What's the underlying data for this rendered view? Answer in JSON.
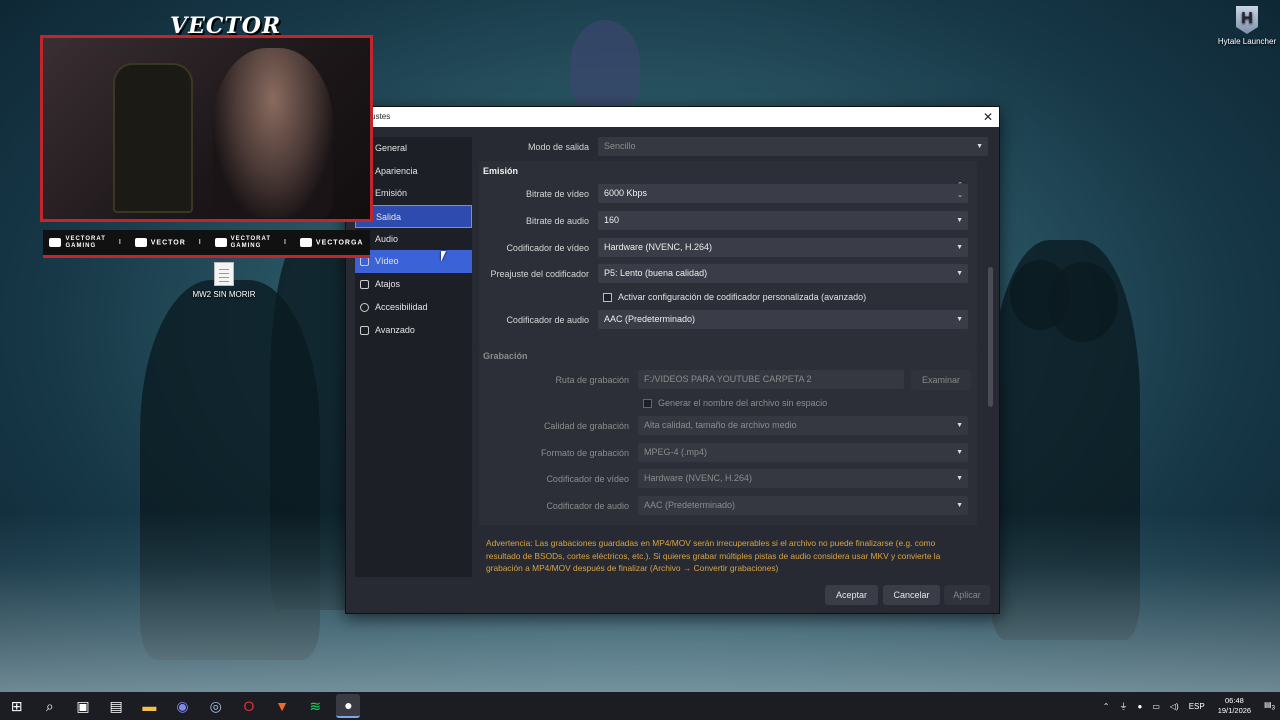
{
  "desktop": {
    "icons": [
      {
        "label": "MW2 SIN MORIR",
        "icon": "text-document-icon"
      },
      {
        "label": "Hytale Launcher",
        "icon": "hytale-launcher-icon"
      }
    ]
  },
  "overlay": {
    "brand": "VECTOR",
    "social": [
      {
        "icon": "youtube-icon",
        "line1": "VECTORAT",
        "line2": "GAMING"
      },
      {
        "icon": "twitch-icon",
        "line1": "VECTOR",
        "line2": ""
      },
      {
        "icon": "twitter-icon",
        "line1": "VECTORAT",
        "line2": "GAMING"
      },
      {
        "icon": "instagram-icon",
        "line1": "VECTORGA",
        "line2": ""
      }
    ]
  },
  "dialog": {
    "title": "Ajustes",
    "close_glyph": "✕",
    "nav": [
      {
        "label": "General",
        "icon": "gear-icon"
      },
      {
        "label": "Apariencia",
        "icon": "palette-icon"
      },
      {
        "label": "Emisión",
        "icon": "broadcast-icon"
      },
      {
        "label": "Salida",
        "icon": "output-icon"
      },
      {
        "label": "Audio",
        "icon": "speaker-icon"
      },
      {
        "label": "Vídeo",
        "icon": "monitor-icon"
      },
      {
        "label": "Atajos",
        "icon": "keyboard-icon"
      },
      {
        "label": "Accesibilidad",
        "icon": "accessibility-icon"
      },
      {
        "label": "Avanzado",
        "icon": "wrench-icon"
      }
    ],
    "output_mode": {
      "label": "Modo de salida",
      "value": "Sencillo"
    },
    "streaming": {
      "title": "Emisión",
      "video_bitrate": {
        "label": "Bitrate de vídeo",
        "value": "6000 Kbps"
      },
      "audio_bitrate": {
        "label": "Bitrate de audio",
        "value": "160"
      },
      "video_encoder": {
        "label": "Codificador de vídeo",
        "value": "Hardware (NVENC, H.264)"
      },
      "encoder_preset": {
        "label": "Preajuste del codificador",
        "value": "P5: Lento (buena calidad)"
      },
      "custom_encoder_check": "Activar configuración de codificador personalizada (avanzado)",
      "audio_encoder": {
        "label": "Codificador de audio",
        "value": "AAC (Predeterminado)"
      }
    },
    "recording": {
      "title": "Grabación",
      "path": {
        "label": "Ruta de grabación",
        "value": "F:/VIDEOS PARA YOUTUBE CARPETA 2"
      },
      "browse": "Examinar",
      "no_space_check": "Generar el nombre del archivo sin espacio",
      "quality": {
        "label": "Calidad de grabación",
        "value": "Alta calidad, tamaño de archivo medio"
      },
      "format": {
        "label": "Formato de grabación",
        "value": "MPEG-4 (.mp4)"
      },
      "video_encoder": {
        "label": "Codificador de vídeo",
        "value": "Hardware (NVENC, H.264)"
      },
      "audio_encoder": {
        "label": "Codificador de audio",
        "value": "AAC (Predeterminado)"
      }
    },
    "warning": "Advertencia: Las grabaciones guardadas en MP4/MOV serán irrecuperables si el archivo no puede finalizarse (e.g. como resultado de BSODs, cortes eléctricos, etc.). Si quieres grabar múltiples pistas de audio considera usar MKV y convierte la grabación a MP4/MOV después de finalizar (Archivo → Convertir grabaciones)",
    "buttons": {
      "accept": "Aceptar",
      "cancel": "Cancelar",
      "apply": "Aplicar"
    }
  },
  "taskbar": {
    "apps": [
      {
        "name": "start-icon",
        "glyph": "⊞"
      },
      {
        "name": "search-icon",
        "glyph": "⌕"
      },
      {
        "name": "task-view-icon",
        "glyph": "▣"
      },
      {
        "name": "media-player-icon",
        "glyph": "▤"
      },
      {
        "name": "file-explorer-icon",
        "glyph": "▬"
      },
      {
        "name": "discord-icon",
        "glyph": "◉"
      },
      {
        "name": "steam-icon",
        "glyph": "◎"
      },
      {
        "name": "opera-icon",
        "glyph": "O"
      },
      {
        "name": "brave-icon",
        "glyph": "▼"
      },
      {
        "name": "spotify-icon",
        "glyph": "≋"
      },
      {
        "name": "obs-icon",
        "glyph": "●"
      }
    ],
    "tray": {
      "language": "ESP",
      "time": "06:48",
      "date": "19/1/2026",
      "notifications": "3"
    }
  }
}
